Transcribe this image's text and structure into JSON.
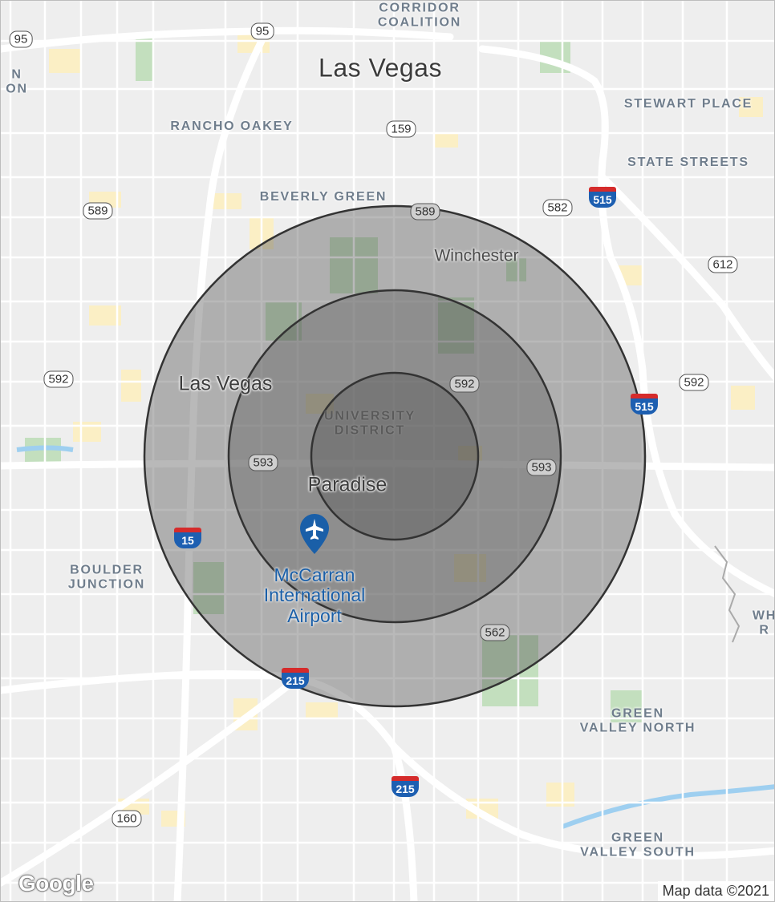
{
  "map": {
    "labels": {
      "las_vegas_city": "Las Vegas",
      "las_vegas_strip": "Las Vegas",
      "paradise": "Paradise",
      "winchester": "Winchester",
      "corridor_coalition": "CORRIDOR\nCOALITION",
      "rancho_oakey": "RANCHO OAKEY",
      "beverly_green": "BEVERLY GREEN",
      "stewart_place": "STEWART PLACE",
      "state_streets": "STATE STREETS",
      "university_district": "UNIVERSITY\nDISTRICT",
      "boulder_junction": "BOULDER\nJUNCTION",
      "green_valley_north": "GREEN\nVALLEY NORTH",
      "green_valley_south": "GREEN\nVALLEY SOUTH",
      "edge_left": "N\nON",
      "edge_right": "WH\nR"
    },
    "airport": {
      "name": "McCarran\nInternational\nAirport",
      "icon": "airplane-icon",
      "pin_color": "#1a5fa8"
    },
    "route_shields": {
      "us95_left": "95",
      "us95_top": "95",
      "r159": "159",
      "r589_left": "589",
      "r589_center": "589",
      "r582": "582",
      "r612": "612",
      "r592_left": "592",
      "r592_center": "592",
      "r592_right": "592",
      "r593_left": "593",
      "r593_right": "593",
      "r562": "562",
      "r160": "160"
    },
    "interstate_shields": {
      "i515_top": "515",
      "i515_mid": "515",
      "i15": "15",
      "i215_left": "215",
      "i215_bottom": "215"
    },
    "radius_rings": {
      "count": 3,
      "fill_color": "#505050",
      "stroke_color": "#333333"
    },
    "colors": {
      "background": "#eeeeee",
      "road": "#ffffff",
      "park": "#c3dfbe",
      "commercial": "#fbefc5",
      "water": "#9ecff0"
    }
  },
  "footer": {
    "logo": "Google",
    "attribution": "Map data ©2021"
  }
}
